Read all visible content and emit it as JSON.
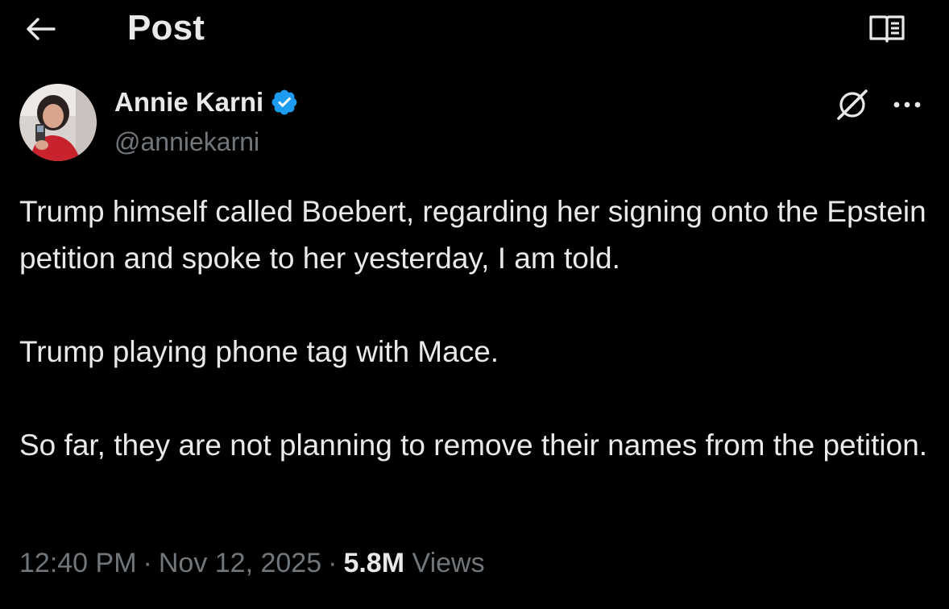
{
  "header": {
    "title": "Post",
    "back_icon": "arrow-left-icon",
    "reader_icon": "reader-mode-icon"
  },
  "author": {
    "display_name": "Annie Karni",
    "handle": "@anniekarni",
    "verified": true,
    "verified_icon": "verified-badge-icon",
    "verified_color": "#1d9bf0"
  },
  "actions": {
    "grok_icon": "grok-icon",
    "more_icon": "more-horizontal-icon"
  },
  "tweet": {
    "paragraphs": [
      "Trump himself called Boebert, regarding her signing onto the Epstein petition and spoke to her yesterday, I am told.",
      "Trump playing phone tag with Mace.",
      "So far, they are not planning to remove their names from the petition."
    ]
  },
  "meta": {
    "time": "12:40 PM",
    "date": "Nov 12, 2025",
    "views_count": "5.8M",
    "views_label": "Views",
    "separator": "·"
  },
  "colors": {
    "background": "#000000",
    "text": "#e7e9ea",
    "muted": "#71767b",
    "accent": "#1d9bf0"
  }
}
